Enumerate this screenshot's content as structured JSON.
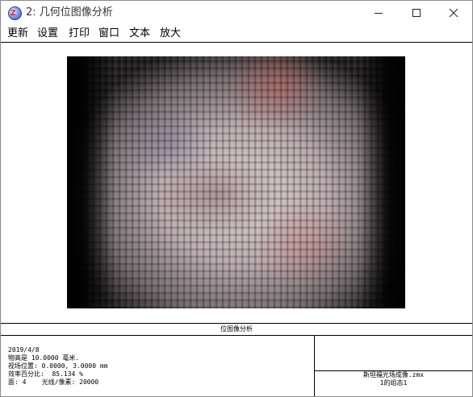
{
  "window": {
    "title": "2: 几何位图像分析",
    "icon": "zemax-app-icon",
    "controls": [
      "minimize-icon",
      "maximize-icon",
      "close-icon"
    ]
  },
  "menu": {
    "items": [
      "更新",
      "设置",
      "打印",
      "窗口",
      "文本",
      "放大"
    ]
  },
  "analysis": {
    "caption": "位图像分析",
    "info": {
      "line1": "2019/4/8",
      "line2": "物高是 10.0000 毫米.",
      "line3": "视场位置: 0.0000, 3.0000 mm",
      "line4": "效率百分比:  85.134 %",
      "line5": "面: 4    光线/像素: 20000"
    },
    "file": {
      "name": "斯坦福光场成像.zmx",
      "config": "1的组态1"
    }
  }
}
